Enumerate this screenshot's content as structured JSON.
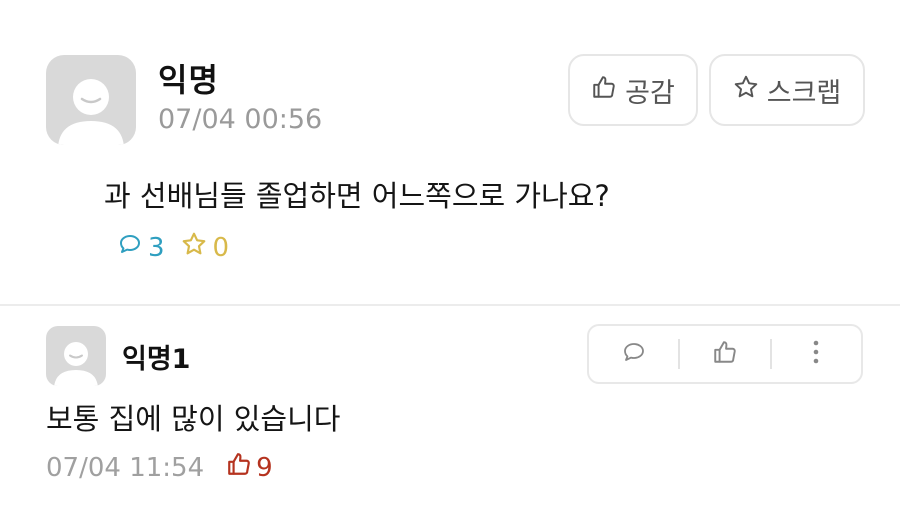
{
  "post": {
    "author": "익명",
    "time": "07/04 00:56",
    "like_label": "공감",
    "scrap_label": "스크랩",
    "body": "과 선배님들 졸업하면 어느쪽으로 가나요?",
    "comment_count": "3",
    "scrap_count": "0"
  },
  "comment": {
    "author": "익명1",
    "body": "보통 집에 많이 있습니다",
    "time": "07/04 11:54",
    "like_count": "9"
  },
  "colors": {
    "comment_stat": "#2f9fc0",
    "scrap_stat": "#d8b94a",
    "like_stat": "#b5331f",
    "avatar_bg": "#d9d9d9"
  }
}
